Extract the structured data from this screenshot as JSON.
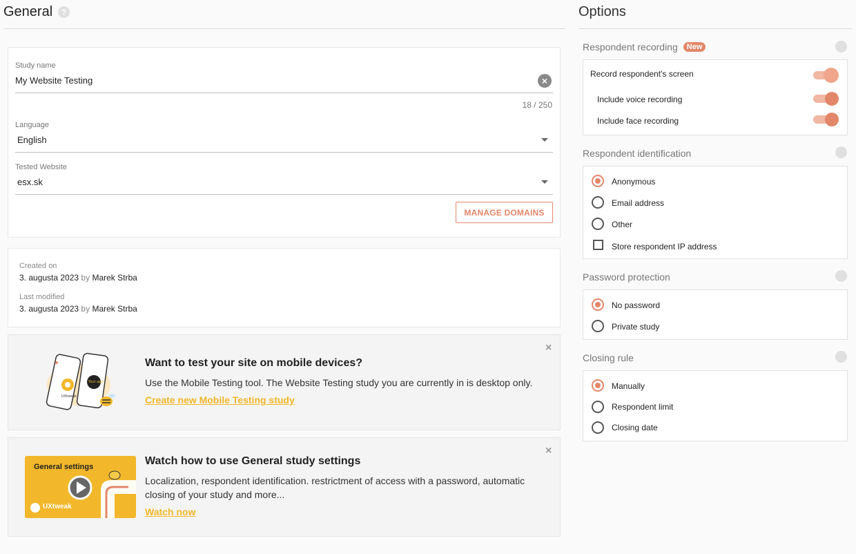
{
  "general": {
    "title": "General",
    "study_name_label": "Study name",
    "study_name_value": "My Website Testing",
    "study_name_counter": "18 / 250",
    "language_label": "Language",
    "language_value": "English",
    "website_label": "Tested Website",
    "website_value": "esx.sk",
    "manage_domains": "MANAGE DOMAINS"
  },
  "meta": {
    "created_label": "Created on",
    "created_date": "3. augusta 2023",
    "created_by_word": "by",
    "created_author": "Marek Strba",
    "modified_label": "Last modified",
    "modified_date": "3. augusta 2023",
    "modified_by_word": "by",
    "modified_author": "Marek Strba"
  },
  "promo_mobile": {
    "title": "Want to test your site on mobile devices?",
    "text": "Use the Mobile Testing tool. The Website Testing study you are currently in is desktop only.",
    "link": "Create new Mobile Testing study",
    "phone_left_label": "UXtweak",
    "phone_right_label": "Your app"
  },
  "promo_video": {
    "title": "Watch how to use General study settings",
    "text": "Localization, respondent identification. restrictment of access with a password, automatic closing of your study and more...",
    "link": "Watch now",
    "thumb_title": "General settings",
    "thumb_brand": "UXtweak"
  },
  "options": {
    "title": "Options",
    "recording": {
      "title": "Respondent recording",
      "badge": "New",
      "screen": "Record respondent's screen",
      "voice": "Include voice recording",
      "face": "Include face recording"
    },
    "identification": {
      "title": "Respondent identification",
      "anonymous": "Anonymous",
      "email": "Email address",
      "other": "Other",
      "store_ip": "Store respondent IP address"
    },
    "password": {
      "title": "Password protection",
      "none": "No password",
      "private": "Private study"
    },
    "closing": {
      "title": "Closing rule",
      "manually": "Manually",
      "limit": "Respondent limit",
      "date": "Closing date"
    }
  },
  "colors": {
    "accent": "#e2876a",
    "link": "#f2b72a"
  }
}
